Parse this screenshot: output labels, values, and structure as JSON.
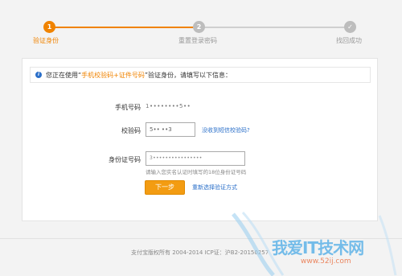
{
  "stepper": {
    "steps": [
      {
        "number": "1",
        "label": "验证身份"
      },
      {
        "number": "2",
        "label": "重置登录密码"
      },
      {
        "number": "✓",
        "label": "找回成功"
      }
    ]
  },
  "notice": {
    "prefix": "您正在使用“",
    "highlight": "手机校验码+证件号码",
    "suffix": "”验证身份，请填写以下信息："
  },
  "form": {
    "phone_label": "手机号码",
    "phone_value": "1••••••••5••",
    "code_label": "校验码",
    "code_value": "5•• ••3",
    "resend_link": "没收到短信校验码?",
    "id_label": "身份证号码",
    "id_value": "3••••••••••••••••",
    "id_hint": "请输入您实名认证时填写的18位身份证号码",
    "next_button": "下一步",
    "reselect_link": "重新选择验证方式"
  },
  "footer": {
    "text": "支付宝版权所有 2004-2014 ICP证：沪B2-20150257"
  },
  "watermark": {
    "title": "我爱IT技术网",
    "url": "www.52ij.com"
  },
  "colors": {
    "accent": "#f08300",
    "link": "#2a6fc9",
    "inactive_step": "#bdbdbd",
    "watermark_blue": "#5fb3e8"
  }
}
